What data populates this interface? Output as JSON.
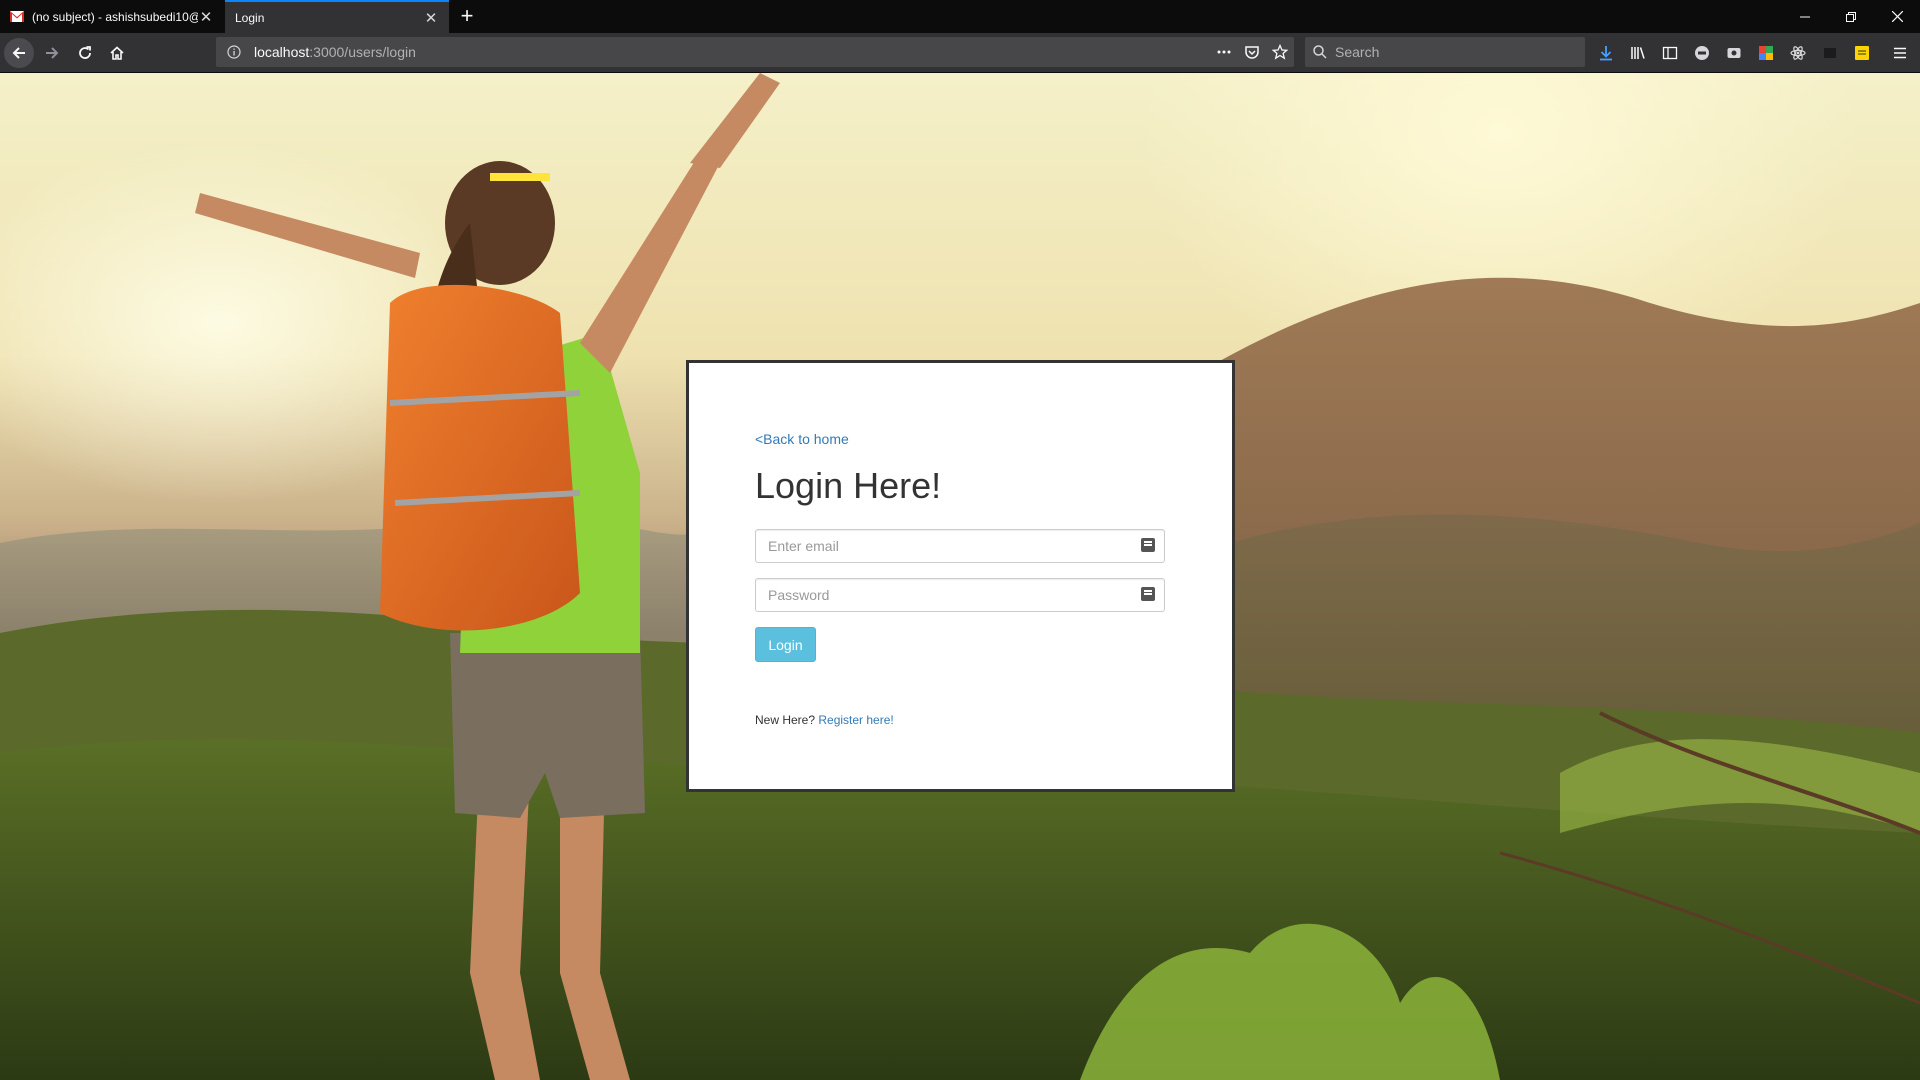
{
  "browser": {
    "tabs": [
      {
        "title": "(no subject) - ashishsubedi10@",
        "active": false,
        "favicon": "gmail-icon"
      },
      {
        "title": "Login",
        "active": true,
        "favicon": ""
      }
    ],
    "url": {
      "host": "localhost",
      "path": ":3000/users/login"
    },
    "search_placeholder": "Search"
  },
  "page": {
    "back_link": "<Back to home",
    "heading": "Login Here!",
    "email_placeholder": "Enter email",
    "password_placeholder": "Password",
    "login_label": "Login",
    "new_here": "New Here? ",
    "register_link": "Register here!"
  },
  "colors": {
    "chrome_dark": "#0c0c0d",
    "toolbar": "#323234",
    "link": "#337ab7",
    "button_info": "#5bc0de"
  }
}
